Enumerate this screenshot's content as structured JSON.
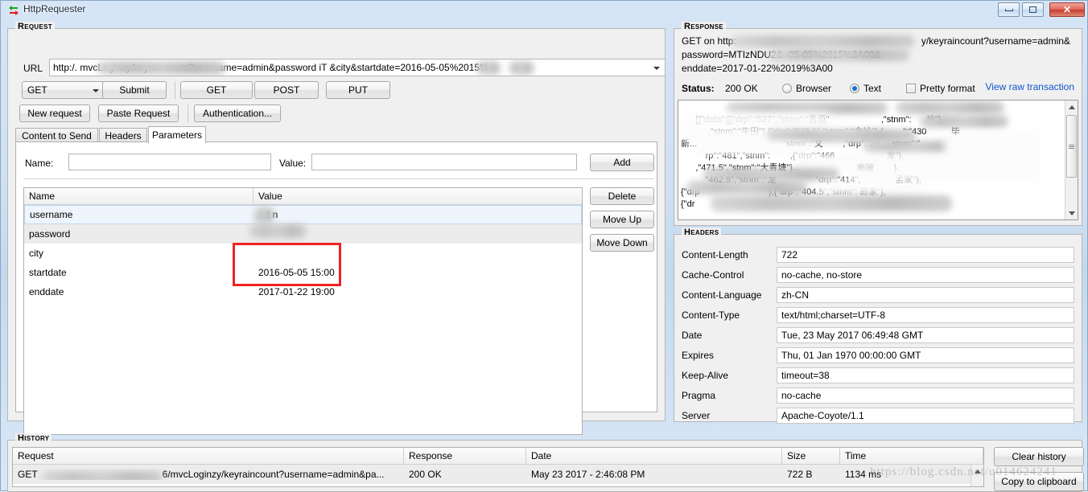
{
  "window": {
    "title": "HttpRequester",
    "icon": "http-arrows-icon",
    "buttons": {
      "minimize": "minimize-icon",
      "maximize": "maximize-icon",
      "close": "close-icon"
    }
  },
  "request": {
    "group_label": "Request",
    "url_label": "URL",
    "url_value": "http:/.                       mvcLoginzy/keyraincount?username=admin&password           iT      &city&startdate=2016-05-05%2015%",
    "method_selected": "GET",
    "submit_label": "Submit",
    "verb_buttons": [
      "GET",
      "POST",
      "PUT"
    ],
    "action_buttons": [
      "New request",
      "Paste Request",
      "Authentication..."
    ],
    "tabs": [
      {
        "label": "Content to Send",
        "active": false
      },
      {
        "label": "Headers",
        "active": false
      },
      {
        "label": "Parameters",
        "active": true
      }
    ],
    "param_editor": {
      "name_label": "Name:",
      "name_value": "",
      "value_label": "Value:",
      "value_value": "",
      "add_label": "Add"
    },
    "param_table": {
      "columns": [
        "Name",
        "Value"
      ],
      "rows": [
        {
          "name": "username",
          "value": "ad   n",
          "state": "selected"
        },
        {
          "name": "password",
          "value": "",
          "state": "alt"
        },
        {
          "name": "city",
          "value": "",
          "state": "normal"
        },
        {
          "name": "startdate",
          "value": "2016-05-05 15:00",
          "state": "normal"
        },
        {
          "name": "enddate",
          "value": "2017-01-22 19:00",
          "state": "normal"
        }
      ]
    },
    "side_buttons": [
      "Delete",
      "Move Up",
      "Move Down"
    ],
    "annotation": {
      "shape": "red-rectangle",
      "color": "#ee2222"
    }
  },
  "response": {
    "group_label": "Response",
    "summary_line1": "GET on http:",
    "summary_line1_tail": "y/keyraincount?username=admin&",
    "summary_line2": "password=MTIzNDU2&                    -05-05%2015%3A00&",
    "summary_line3": "enddate=2017-01-22%2019%3A00",
    "status_label": "Status:",
    "status_value": "200 OK",
    "view_options": [
      {
        "label": "Browser",
        "type": "radio",
        "checked": false
      },
      {
        "label": "Text",
        "type": "radio",
        "checked": true
      },
      {
        "label": "Pretty format",
        "type": "checkbox",
        "checked": false
      }
    ],
    "raw_link": "View raw transaction",
    "body_text": "[{\"data\":[{\"drp\":\"527\",\"stnm\":\"青原\"                     ,\"stnm\":      岭\"},\n           ,\"stnm\":\"牛田\"},{\"drp\":\"525.5\",\"stnm\":\"金岭\"},{        \":\"430          毕\n新...                                   \"stnm\":\"文        ,\"drp\":\"25     stnm\":\"\n          rp\":\"481\",\"stnm\":        ,{\"drp\":\"466                     龙\"},\n      ,\"471.5\",\"stnm\":\"大青塘\"}...                       南陂        },\n          \"462.5\",\"stnm\":\"龙                \"drp\":\"414\",              孟家\"},\n{\"drp                            },{\"drp\":\"404.5\",\"stnm\": 郎家\"},\n{\"dr                                                             ...",
    "scrollbar": "vertical-scrollbar"
  },
  "headers": {
    "group_label": "Headers",
    "rows": [
      {
        "key": "Content-Length",
        "value": "722"
      },
      {
        "key": "Cache-Control",
        "value": "no-cache, no-store"
      },
      {
        "key": "Content-Language",
        "value": "zh-CN"
      },
      {
        "key": "Content-Type",
        "value": "text/html;charset=UTF-8"
      },
      {
        "key": "Date",
        "value": "Tue, 23 May 2017 06:49:48 GMT"
      },
      {
        "key": "Expires",
        "value": "Thu, 01 Jan 1970 00:00:00 GMT"
      },
      {
        "key": "Keep-Alive",
        "value": "timeout=38"
      },
      {
        "key": "Pragma",
        "value": "no-cache"
      },
      {
        "key": "Server",
        "value": "Apache-Coyote/1.1"
      }
    ]
  },
  "history": {
    "group_label": "History",
    "columns": [
      "Request",
      "Response",
      "Date",
      "Size",
      "Time"
    ],
    "rows": [
      {
        "request": "GET",
        "request_tail": "6/mvcLoginzy/keyraincount?username=admin&pa...",
        "response": "200 OK",
        "date": "May 23 2017 - 2:46:08 PM",
        "size": "722 B",
        "time": "1134 ms"
      }
    ],
    "clear_label": "Clear history",
    "copy_label": "Copy to clipboard"
  },
  "watermark": "https://blog.csdn.net/u014624241"
}
